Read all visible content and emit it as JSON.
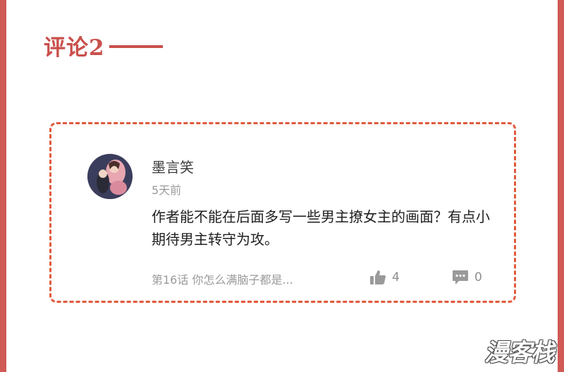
{
  "section": {
    "title": "评论2"
  },
  "comment": {
    "username": "墨言笑",
    "time_ago": "5天前",
    "body": "作者能不能在后面多写一些男主撩女主的画面？有点小期待男主转守为攻。",
    "chapter_ref": "第16话 你怎么满脑子都是...",
    "likes": "4",
    "replies": "0"
  },
  "icons": {
    "like": "thumbs-up-icon",
    "reply": "comment-bubble-icon"
  },
  "colors": {
    "frame": "#cf5a56",
    "title": "#c9504c",
    "card_border": "#e05a3c"
  },
  "watermark": {
    "text": "漫客栈"
  }
}
